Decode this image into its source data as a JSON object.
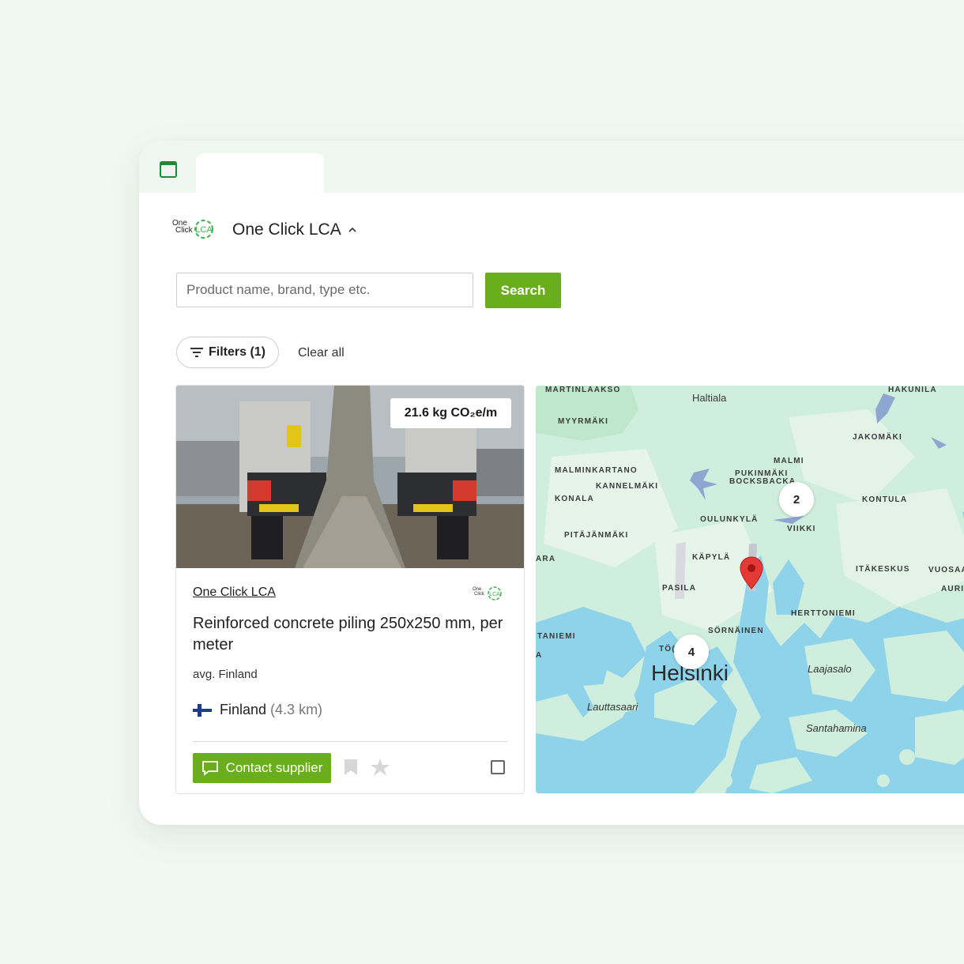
{
  "brand": {
    "logo_line1": "One",
    "logo_line2": "Click",
    "logo_mark": "LCA",
    "name": "One Click LCA"
  },
  "search": {
    "placeholder": "Product name, brand, type etc.",
    "button_label": "Search"
  },
  "filters": {
    "button_label": "Filters (1)",
    "clear_label": "Clear all"
  },
  "product": {
    "co2_badge": "21.6 kg CO₂e/m",
    "supplier": "One Click LCA",
    "title": "Reinforced concrete piling 250x250 mm, per meter",
    "subtitle": "avg. Finland",
    "country": "Finland",
    "distance": "(4.3 km)",
    "contact_label": "Contact supplier"
  },
  "map": {
    "labels": {
      "martinlaakso": "MARTINLAAKSO",
      "haltiala": "Haltiala",
      "hakunila": "HAKUNILA",
      "myyrmaki": "MYYRMÄKI",
      "jakomaki": "JAKOMÄKI",
      "malmi": "MALMI",
      "malminkartano": "MALMINKARTANO",
      "pukinmaki": "PUKINMÄKI",
      "bocksbacka": "BOCKSBACKA",
      "kannelmaki": "KANNELMÄKI",
      "konala": "KONALA",
      "kontula": "KONTULA",
      "oulunkyla": "OULUNKYLÄ",
      "viikki": "VIIKKI",
      "pitajanmaki": "PITÄJÄNMÄKI",
      "ara": "ARA",
      "kapyla": "KÄPYLÄ",
      "itakeskus": "ITÄKESKUS",
      "vuosaari": "VUOSAA",
      "auri": "AURI",
      "pasila": "PASILA",
      "herttoniemi": "HERTTONIEMI",
      "taniemi": "TANIEMI",
      "sornainen": "SÖRNÄINEN",
      "too": "TÖ(",
      "helsinki": "Helsinki",
      "laajasalo": "Laajasalo",
      "lauttasaari": "Lauttasaari",
      "santahamina": "Santahamina",
      "a": "A"
    },
    "clusters": [
      "2",
      "4"
    ]
  },
  "colors": {
    "accent_green": "#6aae1e",
    "map_land": "#cfeedd",
    "map_water": "#8ed3ea",
    "pin": "#e53935"
  },
  "icons": [
    "window-icon",
    "chevron-up-icon",
    "filter-icon",
    "finland-flag-icon",
    "chat-icon",
    "bookmark-icon",
    "star-icon",
    "map-pin-icon"
  ]
}
